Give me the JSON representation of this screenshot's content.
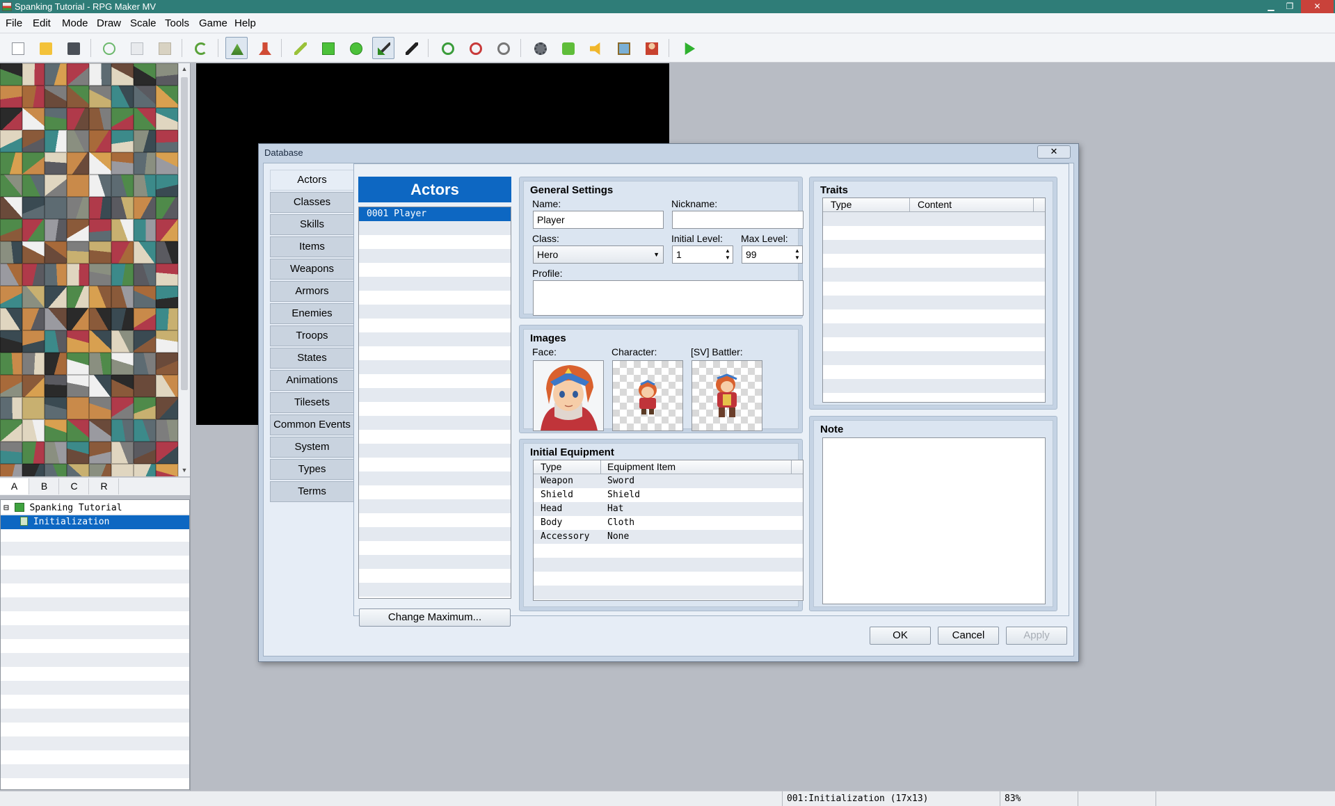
{
  "window": {
    "title": "Spanking Tutorial - RPG Maker MV",
    "minimize": "▁",
    "maximize": "❐",
    "close": "✕"
  },
  "menu": [
    "File",
    "Edit",
    "Mode",
    "Draw",
    "Scale",
    "Tools",
    "Game",
    "Help"
  ],
  "toolbar": [
    "new-project",
    "open-project",
    "save-project",
    "cut",
    "copy",
    "paste",
    "undo",
    "map-mode",
    "event-mode",
    "pencil",
    "rectangle",
    "ellipse",
    "flood-fill",
    "shadow-pen",
    "zoom-in",
    "zoom-out",
    "actual-size",
    "database",
    "plugin-manager",
    "sound-test",
    "event-searcher",
    "character-generator",
    "playtest"
  ],
  "tileset_tabs": [
    "A",
    "B",
    "C",
    "R"
  ],
  "map_tree": {
    "project": "Spanking Tutorial",
    "maps": [
      "Initialization"
    ],
    "expander": "⊟"
  },
  "status": {
    "map": "001:Initialization (17x13)",
    "zoom": "83%"
  },
  "dialog": {
    "title": "Database",
    "close": "✕",
    "categories": [
      "Actors",
      "Classes",
      "Skills",
      "Items",
      "Weapons",
      "Armors",
      "Enemies",
      "Troops",
      "States",
      "Animations",
      "Tilesets",
      "Common Events",
      "System",
      "Types",
      "Terms"
    ],
    "list_header": "Actors",
    "list_items": [
      "0001 Player"
    ],
    "change_max": "Change Maximum...",
    "general": {
      "title": "General Settings",
      "name_label": "Name:",
      "name": "Player",
      "nickname_label": "Nickname:",
      "nickname": "",
      "class_label": "Class:",
      "class": "Hero",
      "init_level_label": "Initial Level:",
      "init_level": "1",
      "max_level_label": "Max Level:",
      "max_level": "99",
      "profile_label": "Profile:",
      "profile": ""
    },
    "images": {
      "title": "Images",
      "face_label": "Face:",
      "character_label": "Character:",
      "battler_label": "[SV] Battler:"
    },
    "equipment": {
      "title": "Initial Equipment",
      "col_type": "Type",
      "col_item": "Equipment Item",
      "rows": [
        {
          "type": "Weapon",
          "item": "Sword"
        },
        {
          "type": "Shield",
          "item": "Shield"
        },
        {
          "type": "Head",
          "item": "Hat"
        },
        {
          "type": "Body",
          "item": "Cloth"
        },
        {
          "type": "Accessory",
          "item": "None"
        }
      ]
    },
    "traits": {
      "title": "Traits",
      "col_type": "Type",
      "col_content": "Content"
    },
    "note": {
      "title": "Note",
      "text": ""
    },
    "ok": "OK",
    "cancel": "Cancel",
    "apply": "Apply"
  }
}
